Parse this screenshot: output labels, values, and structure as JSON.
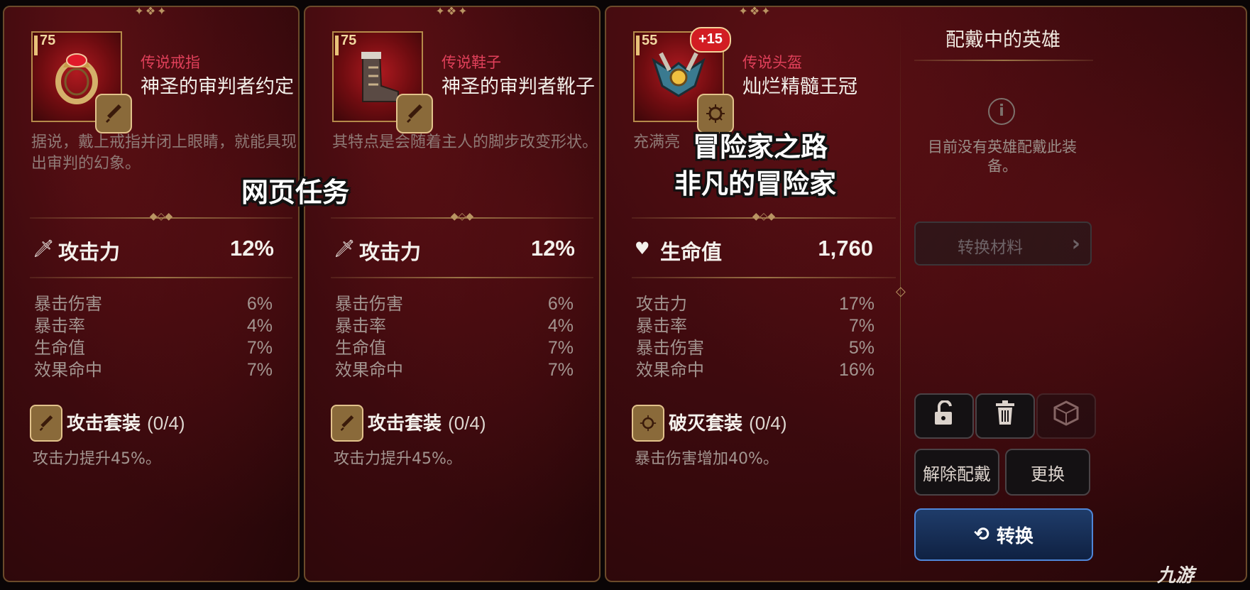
{
  "cards": [
    {
      "level": "75",
      "plus": "",
      "item_icon": "ring",
      "set_icon": "sword-emblem",
      "rarity": "传说戒指",
      "name": "神圣的审判者约定",
      "description": "据说，戴上戒指并闭上眼睛，就能具现出审判的幻象。",
      "main_stat": {
        "icon": "sword-icon",
        "label": "攻击力",
        "value": "12%"
      },
      "sub_stats": [
        {
          "label": "暴击伤害",
          "value": "6%"
        },
        {
          "label": "暴击率",
          "value": "4%"
        },
        {
          "label": "生命值",
          "value": "7%"
        },
        {
          "label": "效果命中",
          "value": "7%"
        }
      ],
      "set": {
        "name": "攻击套装",
        "count": "(0/4)",
        "effect": "攻击力提升45%。"
      }
    },
    {
      "level": "75",
      "plus": "",
      "item_icon": "boots",
      "set_icon": "sword-emblem",
      "rarity": "传说鞋子",
      "name": "神圣的审判者靴子",
      "description": "其特点是会随着主人的脚步改变形状。",
      "main_stat": {
        "icon": "sword-icon",
        "label": "攻击力",
        "value": "12%"
      },
      "sub_stats": [
        {
          "label": "暴击伤害",
          "value": "6%"
        },
        {
          "label": "暴击率",
          "value": "4%"
        },
        {
          "label": "生命值",
          "value": "7%"
        },
        {
          "label": "效果命中",
          "value": "7%"
        }
      ],
      "set": {
        "name": "攻击套装",
        "count": "(0/4)",
        "effect": "攻击力提升45%。"
      }
    },
    {
      "level": "55",
      "plus": "+15",
      "item_icon": "helmet",
      "set_icon": "destruction-emblem",
      "rarity": "传说头盔",
      "name": "灿烂精髓王冠",
      "description": "充满亮",
      "main_stat": {
        "icon": "heart-icon",
        "label": "生命值",
        "value": "1,760"
      },
      "sub_stats": [
        {
          "label": "攻击力",
          "value": "17%"
        },
        {
          "label": "暴击率",
          "value": "7%"
        },
        {
          "label": "暴击伤害",
          "value": "5%"
        },
        {
          "label": "效果命中",
          "value": "16%"
        }
      ],
      "set": {
        "name": "破灭套装",
        "count": "(0/4)",
        "effect": "暴击伤害增加40%。"
      }
    }
  ],
  "overlays": {
    "left": "网页任务",
    "right_line1": "冒险家之路",
    "right_line2": "非凡的冒险家"
  },
  "side_panel": {
    "title": "配戴中的英雄",
    "notice": "目前没有英雄配戴此装备。",
    "convert_materials": "转换材料",
    "unequip": "解除配戴",
    "replace": "更换",
    "exchange": "转换",
    "icons": [
      "unlock-icon",
      "trash-icon",
      "dice-icon"
    ]
  },
  "watermark": "九游",
  "colors": {
    "rarity": "#e0405a",
    "exchange_button": "#1f3c6a",
    "plus_badge": "#d21d23"
  }
}
